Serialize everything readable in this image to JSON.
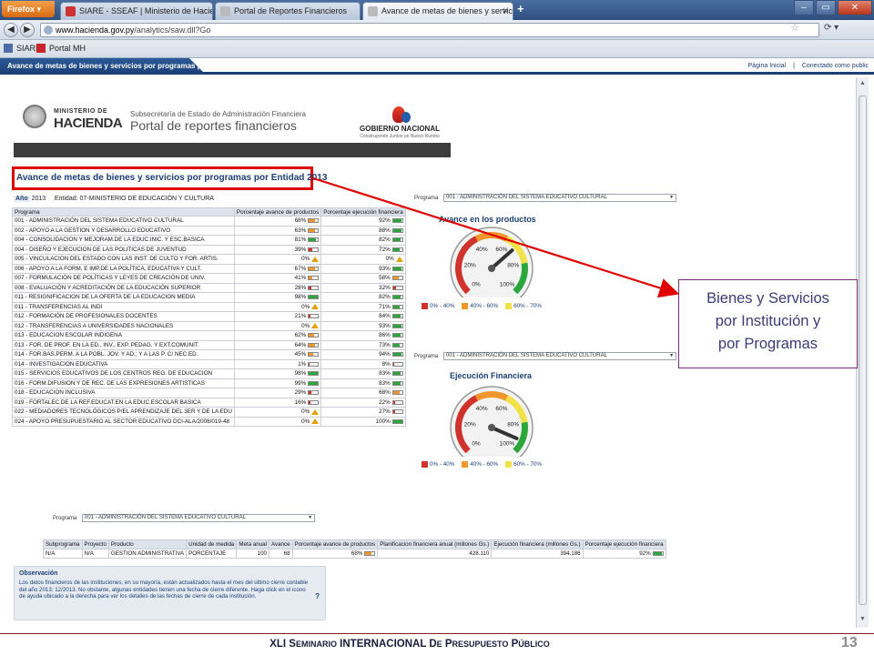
{
  "browser": {
    "menu_label": "Firefox",
    "tabs": [
      {
        "label": "SIARE - SSEAF | Ministerio de Hacienda",
        "active": false
      },
      {
        "label": "Portal de Reportes Financieros",
        "active": false
      },
      {
        "label": "Avance de metas de bienes y servicio...",
        "active": true
      }
    ],
    "url_host": "www.hacienda.gov.py",
    "url_path": "/analytics/saw.dll?Go",
    "bookmarks": [
      "SIARE",
      "Portal MH"
    ]
  },
  "app": {
    "header_title": "Avance de metas de bienes y servicios por programas por Enti...",
    "links": [
      "Página Inicial",
      "Conectado como public"
    ]
  },
  "banner": {
    "ministry_small": "MINISTERIO DE",
    "ministry_big": "HACIENDA",
    "subtitle_small": "Subsecretaría de Estado de Administración Financiera",
    "subtitle_big": "Portal de reportes financieros",
    "gob_big": "GOBIERNO NACIONAL",
    "gob_small": "Construyendo Juntos un Nuevo Rumbo"
  },
  "report": {
    "title": "Avance de metas de bienes y servicios por programas por Entidad 2013",
    "year_label": "Año",
    "year_value": "2013",
    "entity_label": "Entidad:",
    "entity_value": "07-MINISTERIO DE EDUCACIÓN Y CULTURA",
    "columns": [
      "Programa",
      "Porcentaje avance de productos",
      "Porcentaje ejecución financiera"
    ],
    "rows": [
      {
        "p": "001 - ADMINISTRACIÓN DEL SISTEMA EDUCATIVO CULTURAL",
        "a": "68%",
        "av": 68,
        "e": "92%",
        "ev": 92
      },
      {
        "p": "002 - APOYO A LA GESTION Y DESARROLLO EDUCATIVO",
        "a": "63%",
        "av": 63,
        "e": "88%",
        "ev": 88
      },
      {
        "p": "004 - CONSOLIDACION Y MEJORAM.DE LA EDUC.INIC. Y ESC.BASICA",
        "a": "81%",
        "av": 81,
        "e": "82%",
        "ev": 82
      },
      {
        "p": "004 - DISEÑO Y EJECUCION DE LAS POLITICAS DE JUVENTUD",
        "a": "39%",
        "av": 39,
        "e": "72%",
        "ev": 72
      },
      {
        "p": "005 - VINCULACION DEL ESTADO CON LAS INST. DE CULTO Y FOR. ARTIS.",
        "a": "0%",
        "av": 0,
        "e": "0%",
        "ev": 0
      },
      {
        "p": "006 - APOYO A LA FORM. E IMP.DE LA POLÍTICA, EDUCATIVA Y CULT.",
        "a": "67%",
        "av": 67,
        "e": "93%",
        "ev": 93
      },
      {
        "p": "007 - FORMULACIÓN DE POLÍTICAS Y LEYES DE CREACIÓN DE UNIV.",
        "a": "41%",
        "av": 41,
        "e": "58%",
        "ev": 58
      },
      {
        "p": "008 - EVALUACIÓN Y ACREDITACIÓN DE LA EDUCACIÓN SUPERIOR",
        "a": "28%",
        "av": 28,
        "e": "32%",
        "ev": 32
      },
      {
        "p": "011 - RESIGNIFICACION DE LA OFERTA DE LA EDUCACION MEDIA",
        "a": "98%",
        "av": 98,
        "e": "82%",
        "ev": 82
      },
      {
        "p": "011 - TRANSFERENCIAS AL INDI",
        "a": "0%",
        "av": 0,
        "e": "71%",
        "ev": 71
      },
      {
        "p": "012 - FORMACIÓN DE PROFESIONALES DOCENTES",
        "a": "21%",
        "av": 21,
        "e": "84%",
        "ev": 84
      },
      {
        "p": "012 - TRANSFERENCIAS A UNIVERSIDADES NACIONALES",
        "a": "0%",
        "av": 0,
        "e": "93%",
        "ev": 93
      },
      {
        "p": "013 - EDUCACION ESCOLAR INDIGENA",
        "a": "62%",
        "av": 62,
        "e": "86%",
        "ev": 86
      },
      {
        "p": "013 - FOR. DE PROF. EN LA ED., INV., EXP. PEDAG. Y EXT.COMUNIT.",
        "a": "64%",
        "av": 64,
        "e": "73%",
        "ev": 73
      },
      {
        "p": "014 - FOR.BAS.PERM. A LA POBL. JOV. Y AD.; Y A LAS P. C/ NEC.ED.",
        "a": "45%",
        "av": 45,
        "e": "94%",
        "ev": 94
      },
      {
        "p": "014 - INVESTIGACION EDUCATIVA",
        "a": "1%",
        "av": 1,
        "e": "8%",
        "ev": 8
      },
      {
        "p": "015 - SERVICIOS EDUCATIVOS DE LOS CENTROS REG. DE EDUCACION",
        "a": "98%",
        "av": 98,
        "e": "83%",
        "ev": 83
      },
      {
        "p": "016 - FORM.DIFUSION Y DE REC. DE LAS EXPRESIONES ARTISTICAS",
        "a": "99%",
        "av": 99,
        "e": "83%",
        "ev": 83
      },
      {
        "p": "018 - EDUCACION INCLUSIVA",
        "a": "29%",
        "av": 29,
        "e": "68%",
        "ev": 68
      },
      {
        "p": "019 - FORTALEC.DE LA REF.EDUCAT.EN LA EDUC.ESCOLAR BASICA",
        "a": "16%",
        "av": 16,
        "e": "22%",
        "ev": 22
      },
      {
        "p": "022 - MEDIADORES TECNOLÓGICOS P/EL APRENDIZAJE DEL 3ER Y DE LA EDU",
        "a": "0%",
        "av": 0,
        "e": "27%",
        "ev": 27
      },
      {
        "p": "024 - APOYO PRESUPUESTARIO AL SECTOR EDUCATIVO DCI-ALA/2008/019-48",
        "a": "0%",
        "av": 0,
        "e": "100%",
        "ev": 100
      }
    ]
  },
  "gauges": {
    "program_label": "Programa",
    "program_value": "001 - ADMINISTRACIÓN DEL SISTEMA EDUCATIVO CULTURAL",
    "tick_labels": [
      "0%",
      "20%",
      "40%",
      "60%",
      "80%",
      "100%"
    ],
    "legend": [
      {
        "label": "0% - 40%",
        "color": "#d0322c"
      },
      {
        "label": "40% - 60%",
        "color": "#f0962a"
      },
      {
        "label": "60% - 70%",
        "color": "#f2e24a"
      }
    ],
    "avance_title": "Avance en los productos",
    "avance_value": 68,
    "ejecucion_title": "Ejecución Financiera",
    "ejecucion_value": 92
  },
  "detail": {
    "program_label": "Programa",
    "program_value": "001 - ADMINISTRACIÓN DEL SISTEMA EDUCATIVO CULTURAL",
    "columns": [
      "Subprograma",
      "Proyecto",
      "Producto",
      "Unidad de medida",
      "Meta anual",
      "Avance",
      "Porcentaje avance de productos",
      "Planificacion financiera anual (millones Gs.)",
      "Ejecución financiera (millones Gs.)",
      "Porcentaje ejecución financiera"
    ],
    "row": {
      "subprograma": "N/A",
      "proyecto": "N/A",
      "producto": "GESTION ADMINISTRATIVA",
      "unidad": "PORCENTAJE",
      "meta": "100",
      "avance": "68",
      "pct_avance": "68%",
      "pct_avance_v": 68,
      "plan": "428.110",
      "ejec": "394.186",
      "pct_ejec": "92%",
      "pct_ejec_v": 92
    }
  },
  "observacion": {
    "title": "Observación",
    "text": "Los datos financieros de las instituciones, en su mayoría, están actualizados hasta el mes del último cierre contable del año 2013: 12/2013. No obstante, algunas entidades tienen una fecha de cierre diferente. Haga click en el icono de ayuda ubicado a la derecha para ver los detalles de las fechas de cierre de cada institución.",
    "help": "?"
  },
  "callout": {
    "lines": [
      "Bienes y Servicios",
      "por Institución y",
      "por Programas"
    ]
  },
  "footer": {
    "text_pre": "XLI S",
    "text_sc1": "EMINARIO",
    "text_mid": " INTERNACIONAL D",
    "text_sc2": "E",
    "text_mid2": " P",
    "text_sc3": "RESUPUESTO",
    "text_mid3": " P",
    "text_sc4": "ÚBLICO",
    "page_number": "13"
  },
  "colors": {
    "low": "#d0322c",
    "mid": "#f0962a",
    "high": "#2aa63a",
    "accent": "#1c3f74"
  }
}
